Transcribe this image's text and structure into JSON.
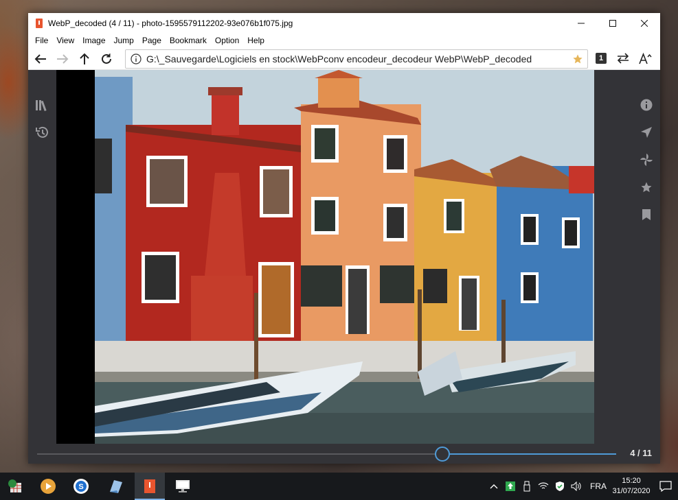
{
  "window": {
    "title": "WebP_decoded (4 / 11) - photo-1595579112202-93e076b1f075.jpg"
  },
  "menu": [
    "File",
    "View",
    "Image",
    "Jump",
    "Page",
    "Bookmark",
    "Option",
    "Help"
  ],
  "toolbar": {
    "address": "G:\\_Sauvegarde\\Logiciels en stock\\WebPconv encodeur_decodeur WebP\\WebP_decoded",
    "page_badge": "1"
  },
  "navigation": {
    "current": 4,
    "total": 11,
    "label": "4 / 11",
    "position_fraction": 0.7
  },
  "taskbar": {
    "language": "FRA",
    "time": "15:20",
    "date": "31/07/2020"
  },
  "colors": {
    "accent": "#4f9bd8",
    "app_icon": "#e8552f",
    "viewer_bg": "#333337"
  }
}
